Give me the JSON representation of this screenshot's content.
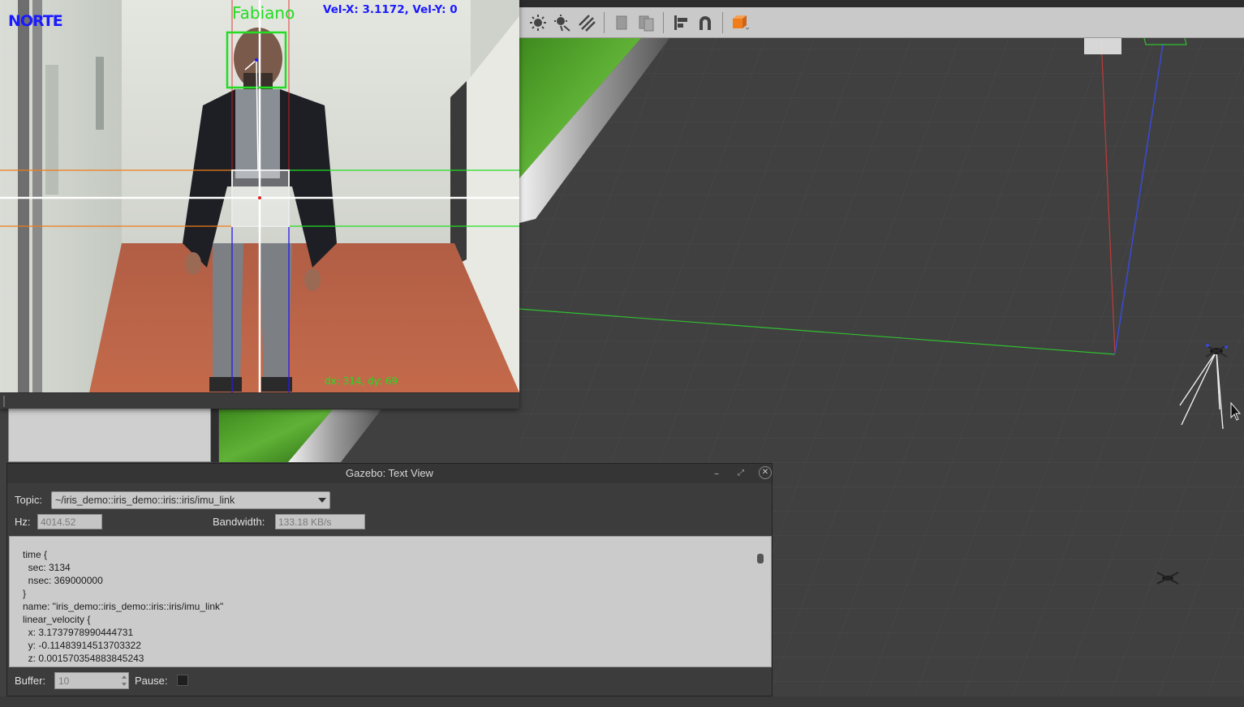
{
  "camera": {
    "heading_label": "NORTE",
    "person_name": "Fabiano",
    "velocity_text": "Vel-X: 3.1172, Vel-Y: 0",
    "offset_text": "dx: 314, dy: 69"
  },
  "textview": {
    "title": "Gazebo: Text View",
    "topic_label": "Topic:",
    "topic_value": "~/iris_demo::iris_demo::iris::iris/imu_link",
    "hz_label": "Hz:",
    "hz_value": "4014.52",
    "bandwidth_label": "Bandwidth:",
    "bandwidth_value": "133.18 KB/s",
    "lines": [
      "time {",
      "  sec: 3134",
      "  nsec: 369000000",
      "}",
      "name: \"iris_demo::iris_demo::iris::iris/imu_link\"",
      "linear_velocity {",
      "  x: 3.1737978990444731",
      "  y: -0.11483914513703322",
      "  z: 0.001570354883845243"
    ],
    "buffer_label": "Buffer:",
    "buffer_value": "10",
    "pause_label": "Pause:"
  },
  "toolbar": {
    "icons": [
      "sun-light-icon",
      "point-light-icon",
      "spot-light-icon",
      "copy-icon",
      "paste-icon",
      "align-icon",
      "magnet-snap-icon",
      "view-angle-icon"
    ]
  },
  "colors": {
    "overlay_blue": "#1a1aff",
    "overlay_green": "#22dd22",
    "toolbar_bg": "#c9c9c9",
    "viewport_bg": "#404040",
    "dialog_bg": "#3c3c3c",
    "accent_orange": "#f07d1a"
  }
}
